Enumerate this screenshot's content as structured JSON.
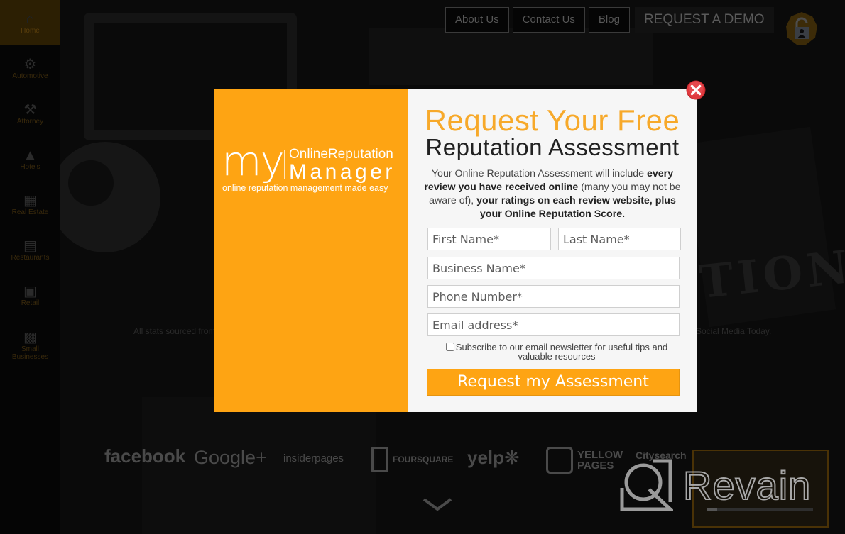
{
  "sidebar": {
    "items": [
      {
        "label": "Home",
        "icon": "home-icon",
        "active": true
      },
      {
        "label": "Automotive",
        "icon": "gears-icon"
      },
      {
        "label": "Attorney",
        "icon": "gavel-icon"
      },
      {
        "label": "Hotels",
        "icon": "hotel-icon"
      },
      {
        "label": "Real Estate",
        "icon": "buildings-icon"
      },
      {
        "label": "Restaurants",
        "icon": "restaurant-icon"
      },
      {
        "label": "Retail",
        "icon": "cart-icon"
      },
      {
        "label": "Small Businesses",
        "icon": "storefront-icon"
      }
    ]
  },
  "nav": {
    "about": "About Us",
    "contact": "Contact Us",
    "blog": "Blog",
    "demo": "REQUEST A DEMO",
    "login_icon": "lock-user-icon"
  },
  "background": {
    "stats_left": "All stats sourced from",
    "stats_right": "Social Media Today.",
    "hero_word": "TION",
    "logos": [
      "facebook",
      "Google+",
      "insiderpages",
      "FOURSQUARE",
      "yelp",
      "YELLOW",
      "PAGES",
      "Citysearch"
    ],
    "video_progress": 0.1
  },
  "modal": {
    "brand": {
      "my": "my",
      "line1": "OnlineReputation",
      "line2": "Manager",
      "tagline": "online reputation management made easy"
    },
    "title_line1": "Request Your Free",
    "title_line2": "Reputation Assessment",
    "description": {
      "p1": "Your Online Reputation Assessment will include ",
      "b1": "every review you have received online",
      "p2": " (many you may not be aware of), ",
      "b2": "your ratings on each review website, plus your Online Reputation Score."
    },
    "fields": {
      "first_name": {
        "placeholder": "First Name*",
        "value": ""
      },
      "last_name": {
        "placeholder": "Last Name*",
        "value": ""
      },
      "business_name": {
        "placeholder": "Business Name*",
        "value": ""
      },
      "phone": {
        "placeholder": "Phone Number*",
        "value": ""
      },
      "email": {
        "placeholder": "Email address*",
        "value": ""
      }
    },
    "subscribe_label": "Subscribe to our email newsletter for useful tips and valuable resources",
    "subscribe_checked": false,
    "submit_label": "Request my Assessment",
    "close_icon": "close-icon"
  },
  "watermark": {
    "text": "Revain"
  },
  "colors": {
    "accent": "#fea413",
    "title_orange": "#f7a92a",
    "close_red": "#e0393e"
  }
}
